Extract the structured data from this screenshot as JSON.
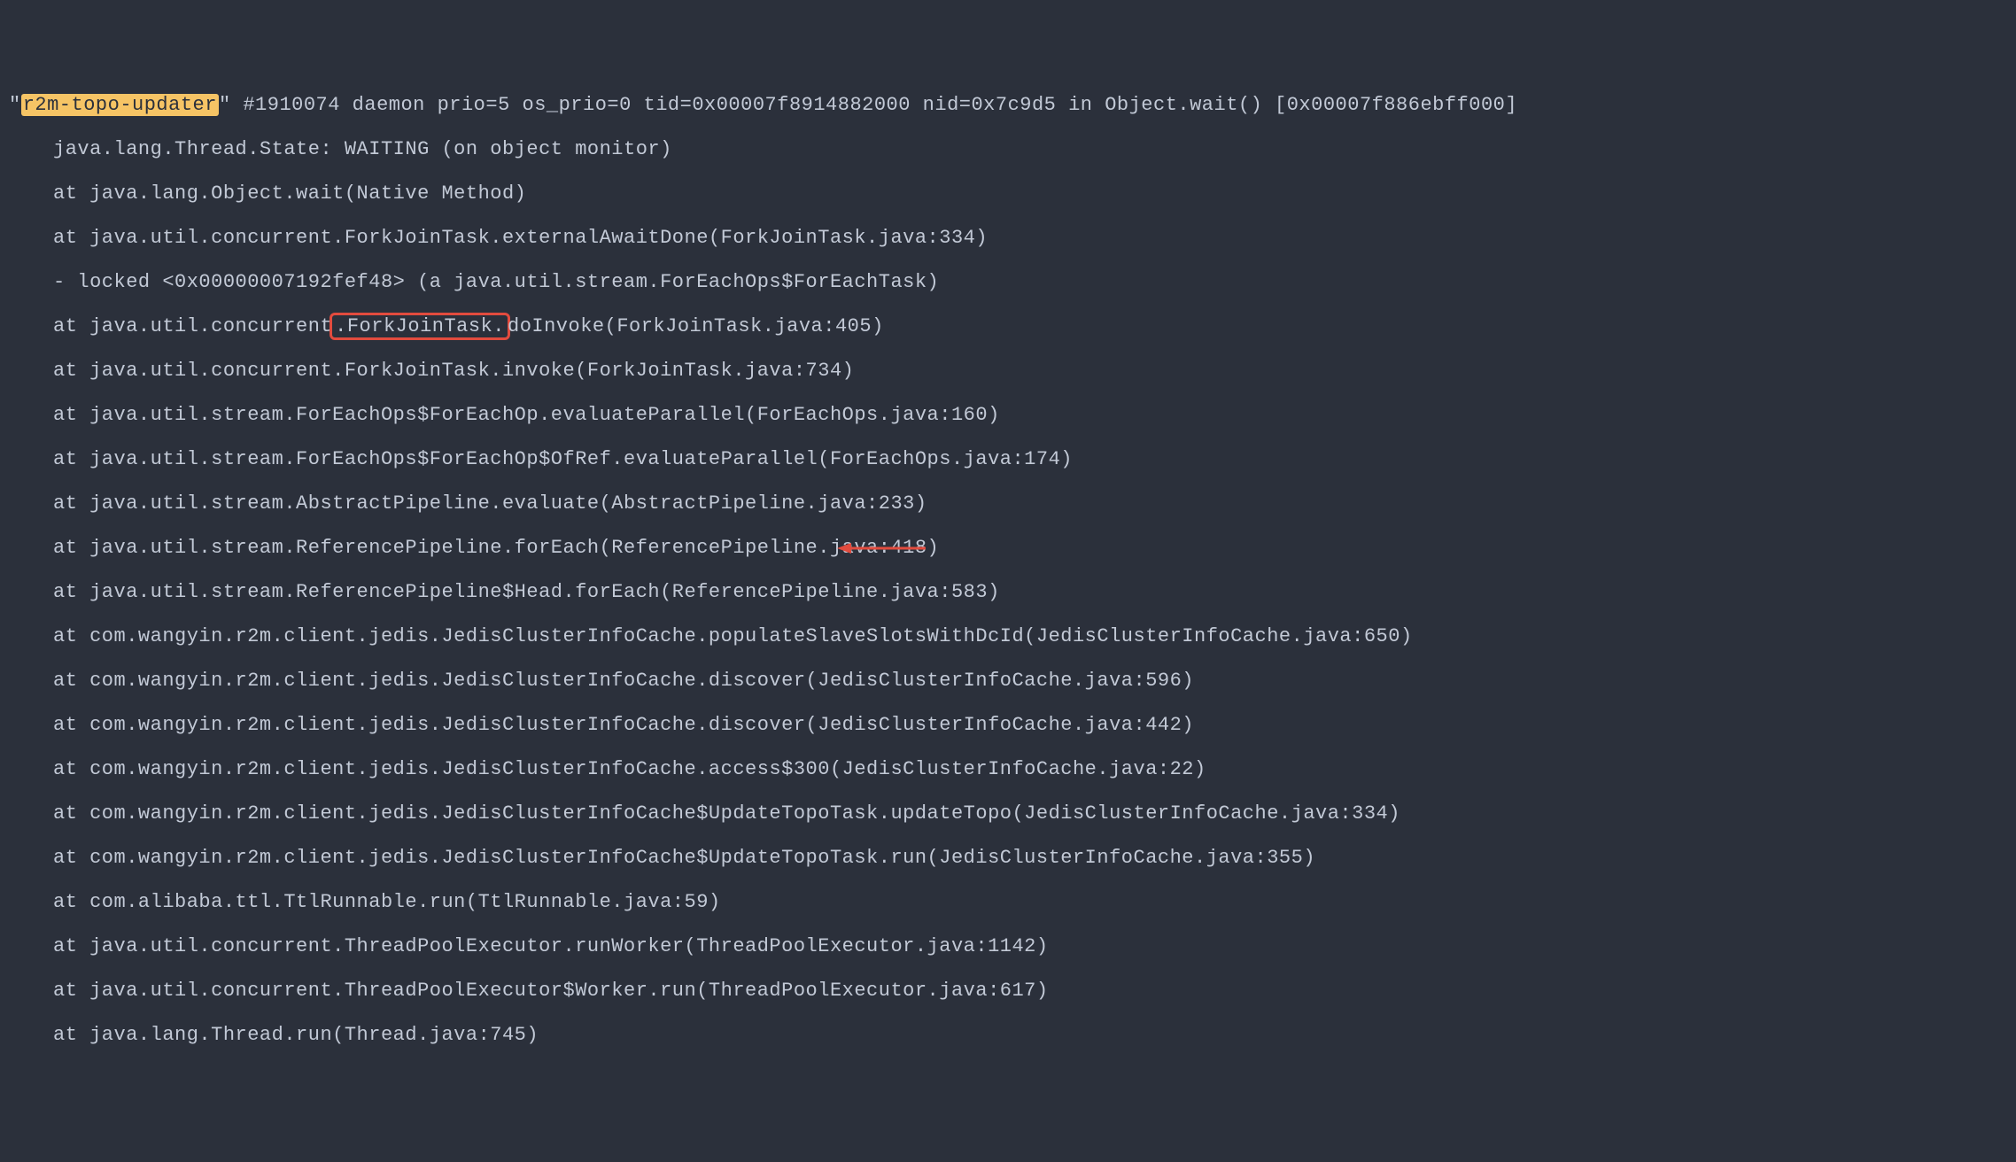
{
  "header": {
    "quote_open": "\"",
    "thread_name": "r2m-topo-updater",
    "after_name": "\" #1910074 daemon prio=5 os_prio=0 tid=0x00007f8914882000 nid=0x7c9d5 in Object.wait() [0x00007f886ebff000]"
  },
  "state_line": "java.lang.Thread.State: WAITING (on object monitor)",
  "lines_before_box": [
    "at java.lang.Object.wait(Native Method)",
    "at java.util.concurrent.ForkJoinTask.externalAwaitDone(ForkJoinTask.java:334)",
    "- locked <0x00000007192fef48> (a java.util.stream.ForEachOps$ForEachTask)"
  ],
  "box_line": {
    "prefix": "at java.util.concurrent",
    "boxed": ".ForkJoinTask.",
    "suffix": "doInvoke(ForkJoinTask.java:405)"
  },
  "lines_mid": [
    "at java.util.concurrent.ForkJoinTask.invoke(ForkJoinTask.java:734)",
    "at java.util.stream.ForEachOps$ForEachOp.evaluateParallel(ForEachOps.java:160)",
    "at java.util.stream.ForEachOps$ForEachOp$OfRef.evaluateParallel(ForEachOps.java:174)",
    "at java.util.stream.AbstractPipeline.evaluate(AbstractPipeline.java:233)"
  ],
  "arrow_line": "at java.util.stream.ReferencePipeline.forEach(ReferencePipeline.java:418)",
  "lines_after": [
    "at java.util.stream.ReferencePipeline$Head.forEach(ReferencePipeline.java:583)",
    "at com.wangyin.r2m.client.jedis.JedisClusterInfoCache.populateSlaveSlotsWithDcId(JedisClusterInfoCache.java:650)",
    "at com.wangyin.r2m.client.jedis.JedisClusterInfoCache.discover(JedisClusterInfoCache.java:596)",
    "at com.wangyin.r2m.client.jedis.JedisClusterInfoCache.discover(JedisClusterInfoCache.java:442)",
    "at com.wangyin.r2m.client.jedis.JedisClusterInfoCache.access$300(JedisClusterInfoCache.java:22)",
    "at com.wangyin.r2m.client.jedis.JedisClusterInfoCache$UpdateTopoTask.updateTopo(JedisClusterInfoCache.java:334)",
    "at com.wangyin.r2m.client.jedis.JedisClusterInfoCache$UpdateTopoTask.run(JedisClusterInfoCache.java:355)",
    "at com.alibaba.ttl.TtlRunnable.run(TtlRunnable.java:59)",
    "at java.util.concurrent.ThreadPoolExecutor.runWorker(ThreadPoolExecutor.java:1142)",
    "at java.util.concurrent.ThreadPoolExecutor$Worker.run(ThreadPoolExecutor.java:617)",
    "at java.lang.Thread.run(Thread.java:745)"
  ]
}
